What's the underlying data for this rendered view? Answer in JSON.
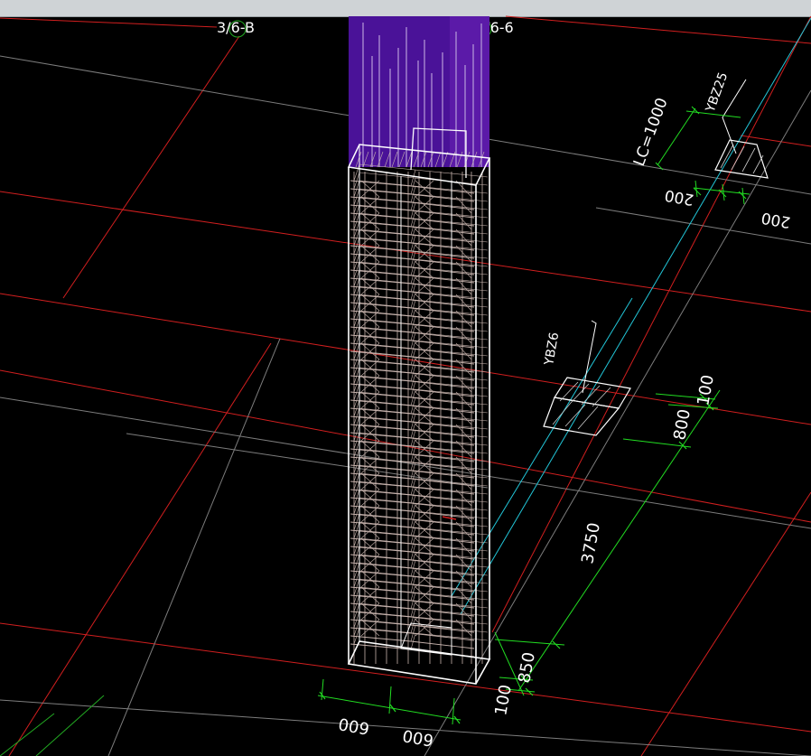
{
  "axis_labels": {
    "left": "3/6-B",
    "right": "1/6-6"
  },
  "dimensions": {
    "column_width_left": "600",
    "column_width_right": "600",
    "cover_bottom": "100",
    "segment_lower": "850",
    "segment_main": "3750",
    "segment_upper": "800",
    "cover_top": "100",
    "lap_length": "LC=1000",
    "stub_width_left": "200",
    "stub_width_right": "200"
  },
  "callouts": {
    "embed_a": "YBZ6",
    "embed_b": "YBZ25"
  },
  "colors": {
    "background": "#000000",
    "gridline_red": "#d21f1f",
    "gridline_gray": "#7d7d7d",
    "dimension_green": "#22dd22",
    "reference_cyan": "#22c6d8",
    "rebar_cage": "#c7b3ad",
    "column_outline": "#ffffff",
    "upper_column": "#5b1aa8",
    "text": "#ffffff",
    "toolbar": "#cfd3d6"
  }
}
